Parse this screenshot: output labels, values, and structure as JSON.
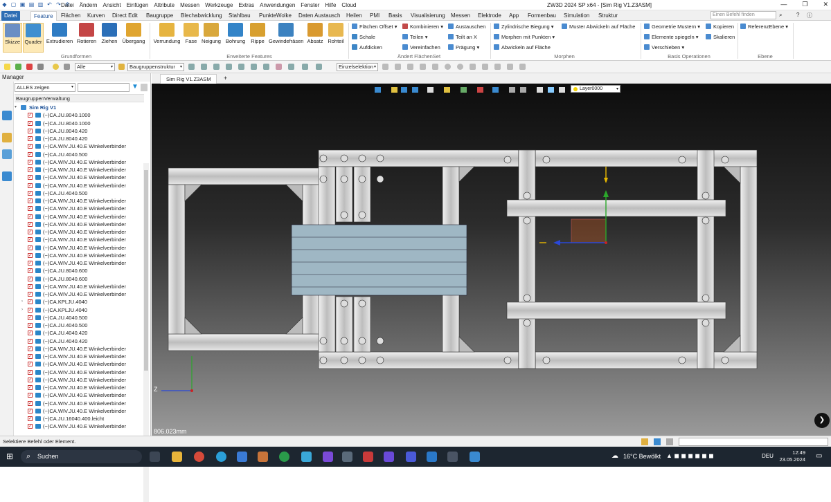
{
  "titlebar": {
    "menu": [
      "Datei",
      "Ändern",
      "Ansicht",
      "Einfügen",
      "Attribute",
      "Messen",
      "Werkzeuge",
      "Extras",
      "Anwendungen",
      "Fenster",
      "Hilfe",
      "Cloud"
    ],
    "title": "ZW3D 2024 SP x64 - [Sim Rig V1.Z3ASM]"
  },
  "tabs": {
    "items": [
      "Datei",
      "Feature",
      "Flächen",
      "Kurven",
      "Direct Edit",
      "Baugruppe",
      "Blechabwicklung",
      "Stahlbau",
      "PunkteWolke",
      "Daten Austausch",
      "Heilen",
      "PMI",
      "Basis",
      "Visualisierung",
      "Messen",
      "Elektrode",
      "App",
      "Formenbau",
      "Simulation",
      "Struktur"
    ],
    "active": "Feature",
    "search_placeholder": "Einen Befehl finden"
  },
  "ribbon": {
    "grundformen": {
      "buttons": [
        "Skizze",
        "Quader",
        "Extrudieren",
        "Rotieren",
        "Ziehen",
        "Übergang"
      ],
      "label": "Grundformen"
    },
    "erweitert": {
      "buttons": [
        "Verrundung",
        "Fase",
        "Neigung",
        "Bohrung",
        "Rippe",
        "Gewindefräsen",
        "Absatz",
        "Rohteil"
      ],
      "label": "Erweiterte Features"
    },
    "flaechenset": {
      "col1": [
        "Flächen Offset",
        "Schale",
        "Aufdicken"
      ],
      "col2": [
        "Kombinieren",
        "Teilen",
        "Vereinfachen"
      ],
      "col3": [
        "Austauschen",
        "Teilt an X",
        "Prägung"
      ],
      "label": "Ändert FlächenSet"
    },
    "morphen": {
      "items": [
        "Zylindrische Biegung",
        "Morphen mit Punkten",
        "Abwickeln auf Fläche",
        "Muster Abwickeln auf Fläche"
      ],
      "label": "Morphen"
    },
    "basis": {
      "items": [
        "Geometrie Mustern",
        "Elemente spiegeln",
        "Verschieben",
        "Kopieren",
        "Skalieren"
      ],
      "label": "Basis Operationen"
    },
    "ebene": {
      "items": [
        "ReferenzEbene"
      ],
      "label": "Ebene"
    }
  },
  "toolbar2": {
    "filter": "Alle",
    "structure": "Baugruppenstruktur",
    "selection": "Einzelselektion"
  },
  "manager": {
    "title": "Manager",
    "filter": "ALLES zeigen",
    "tree_header": "BaugruppenVerwaltung",
    "root": "Sim Rig V1",
    "items": [
      "(−)CA.JU.8040.1000",
      "(−)CA.JU.8040.1000",
      "(−)CA.JU.8040.420",
      "(−)CA.JU.8040.420",
      "(−)CA.WIV.JU.40.E Winkelverbinder",
      "(−)CA.JU.4040.500",
      "(−)CA.WIV.JU.40.E Winkelverbinder",
      "(−)CA.WIV.JU.40.E Winkelverbinder",
      "(−)CA.WIV.JU.40.E Winkelverbinder",
      "(−)CA.WIV.JU.40.E Winkelverbinder",
      "(−)CA.JU.4040.500",
      "(−)CA.WIV.JU.40.E Winkelverbinder",
      "(−)CA.WIV.JU.40.E Winkelverbinder",
      "(−)CA.WIV.JU.40.E Winkelverbinder",
      "(−)CA.WIV.JU.40.E Winkelverbinder",
      "(−)CA.WIV.JU.40.E Winkelverbinder",
      "(−)CA.WIV.JU.40.E Winkelverbinder",
      "(−)CA.WIV.JU.40.E Winkelverbinder",
      "(−)CA.WIV.JU.40.E Winkelverbinder",
      "(−)CA.WIV.JU.40.E Winkelverbinder",
      "(−)CA.JU.8040.600",
      "(−)CA.JU.8040.600",
      "(−)CA.WIV.JU.40.E Winkelverbinder",
      "(−)CA.WIV.JU.40.E Winkelverbinder",
      "(−)CA.KPLJU.4040",
      "(−)CA.KPLJU.4040",
      "(−)CA.JU.4040.500",
      "(−)CA.JU.4040.500",
      "(−)CA.JU.4040.420",
      "(−)CA.JU.4040.420",
      "(−)CA.WIV.JU.40.E Winkelverbinder",
      "(−)CA.WIV.JU.40.E Winkelverbinder",
      "(−)CA.WIV.JU.40.E Winkelverbinder",
      "(−)CA.WIV.JU.40.E Winkelverbinder",
      "(−)CA.WIV.JU.40.E Winkelverbinder",
      "(−)CA.WIV.JU.40.E Winkelverbinder",
      "(−)CA.WIV.JU.40.E Winkelverbinder",
      "(−)CA.WIV.JU.40.E Winkelverbinder",
      "(−)CA.WIV.JU.40.E Winkelverbinder",
      "(−)CA.JU.16040.400.leicht",
      "(−)CA.WIV.JU.40.E Winkelverbinder",
      "(−)CA.WIV.JU.40.E Winkelverbinder"
    ]
  },
  "doc": {
    "tab": "Sim Rig V1.Z3ASM",
    "layer": "Layer0000",
    "dimension": "806.023mm",
    "axis_z": "Z"
  },
  "status": {
    "message": "Selektiere Befehl oder Element."
  },
  "taskbar": {
    "search": "Suchen",
    "weather": "16°C  Bewölkt",
    "lang": "DEU",
    "time": "12:49",
    "date": "23.05.2024"
  }
}
